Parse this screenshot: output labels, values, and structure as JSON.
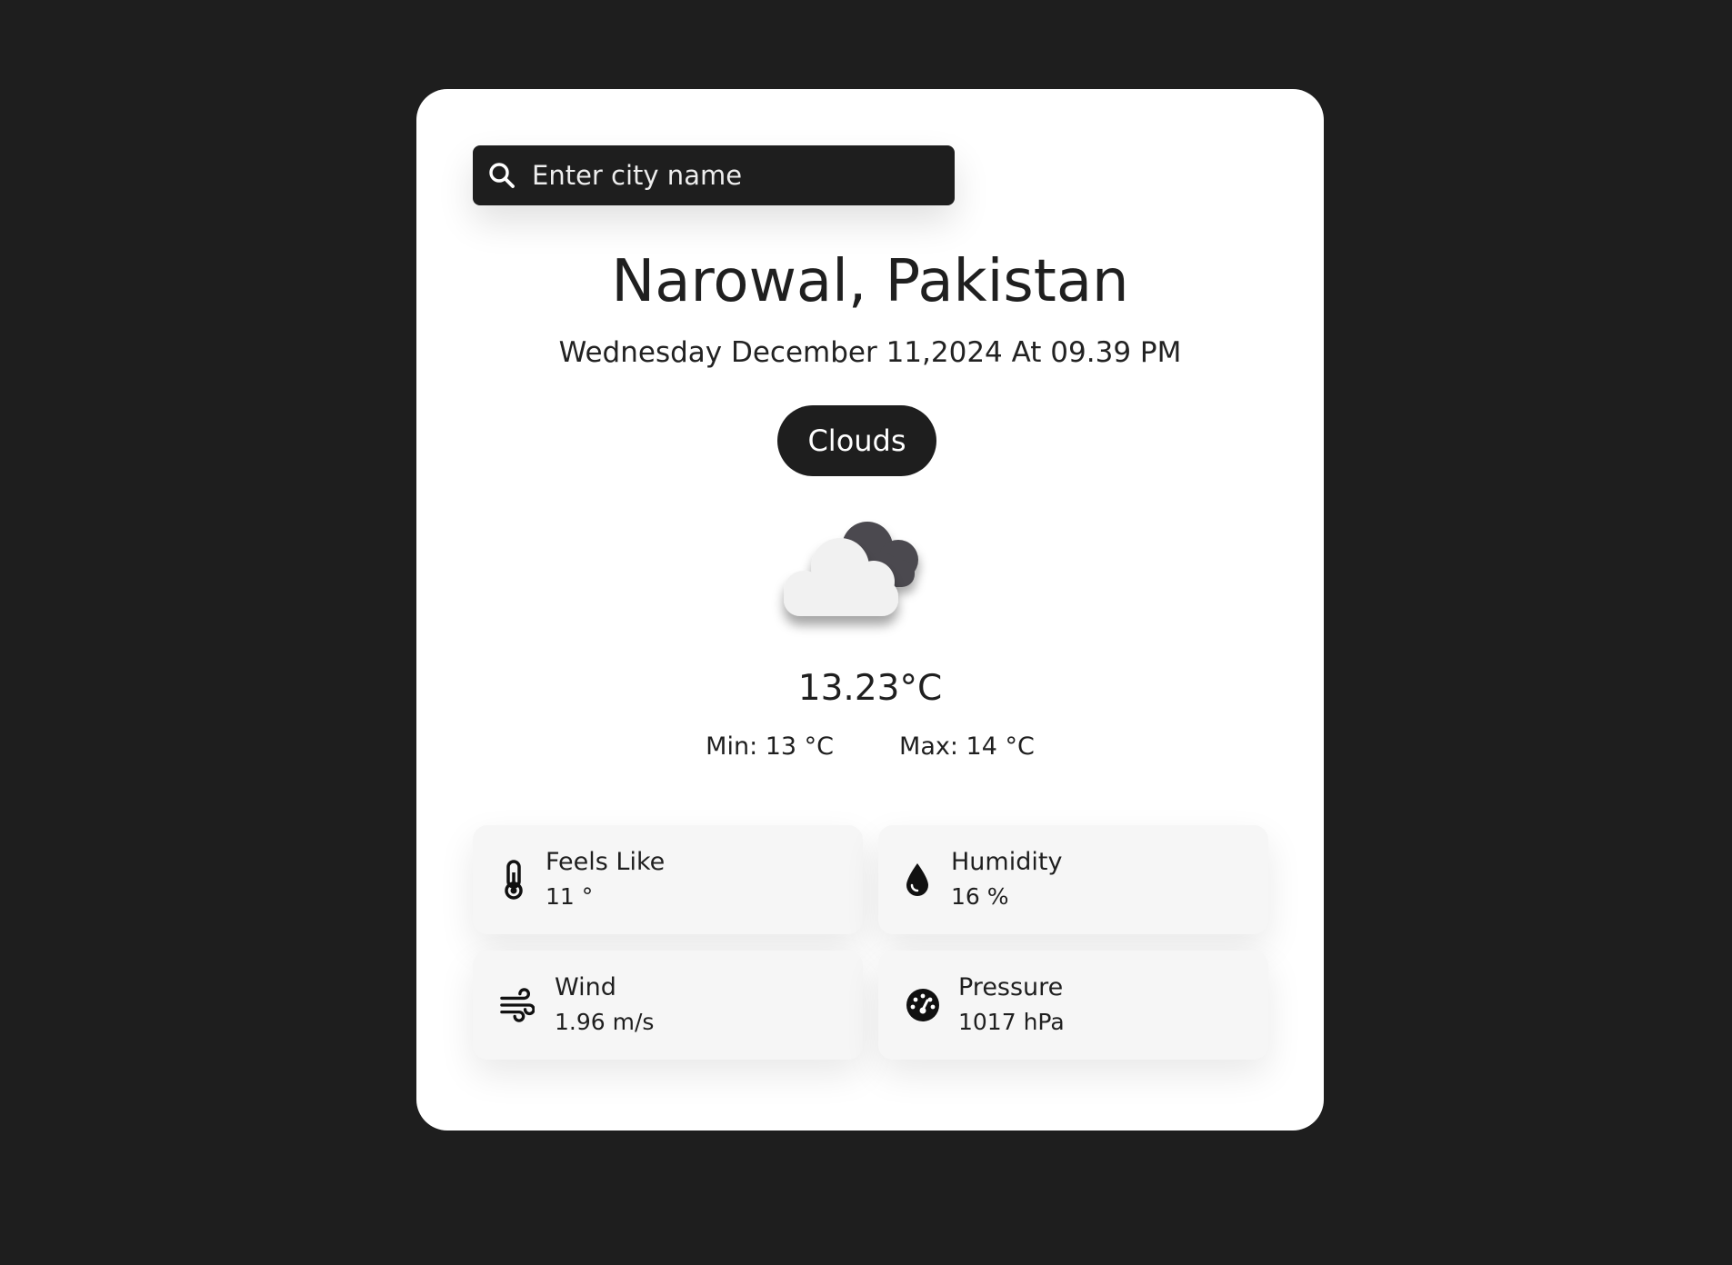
{
  "search": {
    "placeholder": "Enter city name",
    "icon": "search-icon"
  },
  "location": {
    "title": "Narowal, Pakistan",
    "datetime": "Wednesday December 11,2024 At 09.39 PM"
  },
  "condition": {
    "label": "Clouds",
    "icon": "clouds-icon"
  },
  "temperature": {
    "current": "13.23°C",
    "min": "Min: 13 °C",
    "max": "Max: 14 °C"
  },
  "stats": [
    {
      "label": "Feels Like",
      "value": "11 °",
      "icon": "thermometer-icon"
    },
    {
      "label": "Humidity",
      "value": "16 %",
      "icon": "droplet-icon"
    },
    {
      "label": "Wind",
      "value": "1.96 m/s",
      "icon": "wind-icon"
    },
    {
      "label": "Pressure",
      "value": "1017 hPa",
      "icon": "gauge-icon"
    }
  ],
  "colors": {
    "background": "#1e1e1e",
    "card": "#ffffff",
    "accent": "#1e1e1e",
    "tile": "#f6f6f6"
  }
}
